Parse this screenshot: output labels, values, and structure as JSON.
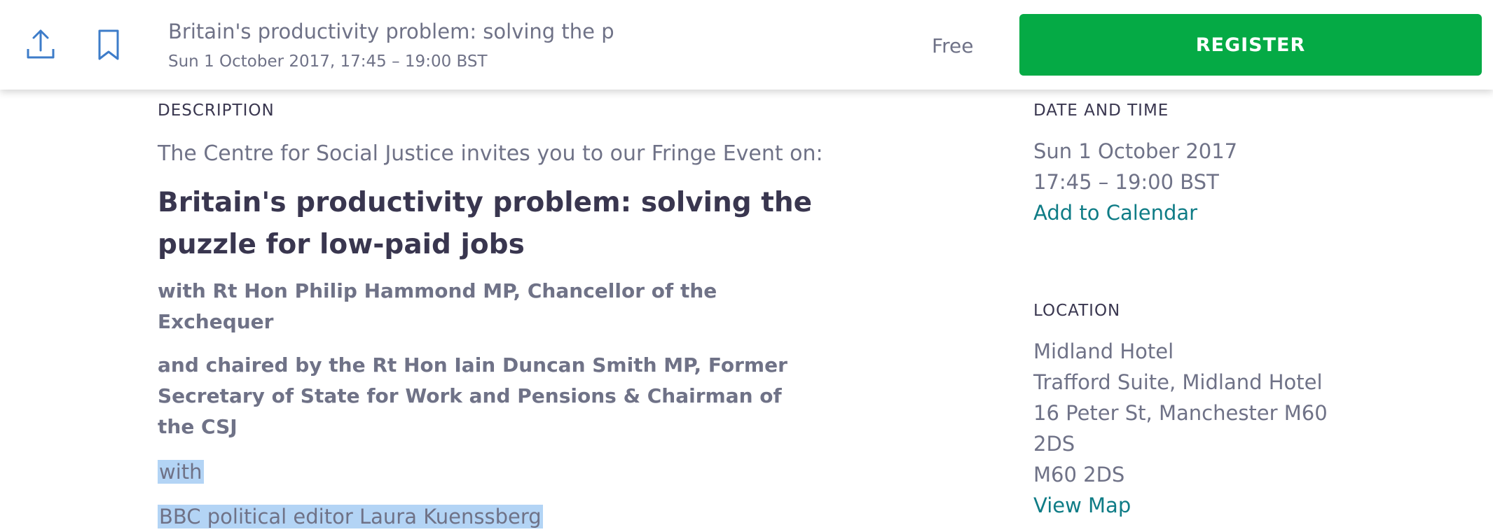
{
  "topbar": {
    "share_icon": "share-upload-icon",
    "bookmark_icon": "bookmark-icon",
    "title": "Britain's productivity problem: solving the p",
    "date": "Sun 1 October 2017, 17:45 – 19:00 BST",
    "price": "Free",
    "register_label": "REGISTER"
  },
  "description": {
    "label": "DESCRIPTION",
    "intro": "The Centre for Social Justice invites you to our Fringe Event on:",
    "heading": "Britain's productivity problem: solving the puzzle for low-paid jobs",
    "speaker": "with Rt Hon Philip Hammond MP, Chancellor of the Exchequer",
    "chair": "and chaired by the Rt Hon Iain Duncan Smith MP, Former Secretary of State for Work and Pensions & Chairman of the CSJ",
    "with_text": "with",
    "guest": "BBC political editor Laura Kuenssberg"
  },
  "date_time": {
    "label": "DATE AND TIME",
    "date": "Sun 1 October 2017",
    "time": "17:45 – 19:00 BST",
    "calendar_link": "Add to Calendar"
  },
  "location": {
    "label": "LOCATION",
    "lines": [
      "Midland Hotel",
      "Trafford Suite, Midland Hotel",
      "16 Peter St, Manchester M60",
      "2DS",
      "M60 2DS"
    ],
    "map_link": "View Map"
  },
  "colors": {
    "register_green": "#05aa45",
    "link_teal": "#0f7c86",
    "icon_blue": "#3d7cc9",
    "selection_highlight": "#b3d4f5"
  }
}
